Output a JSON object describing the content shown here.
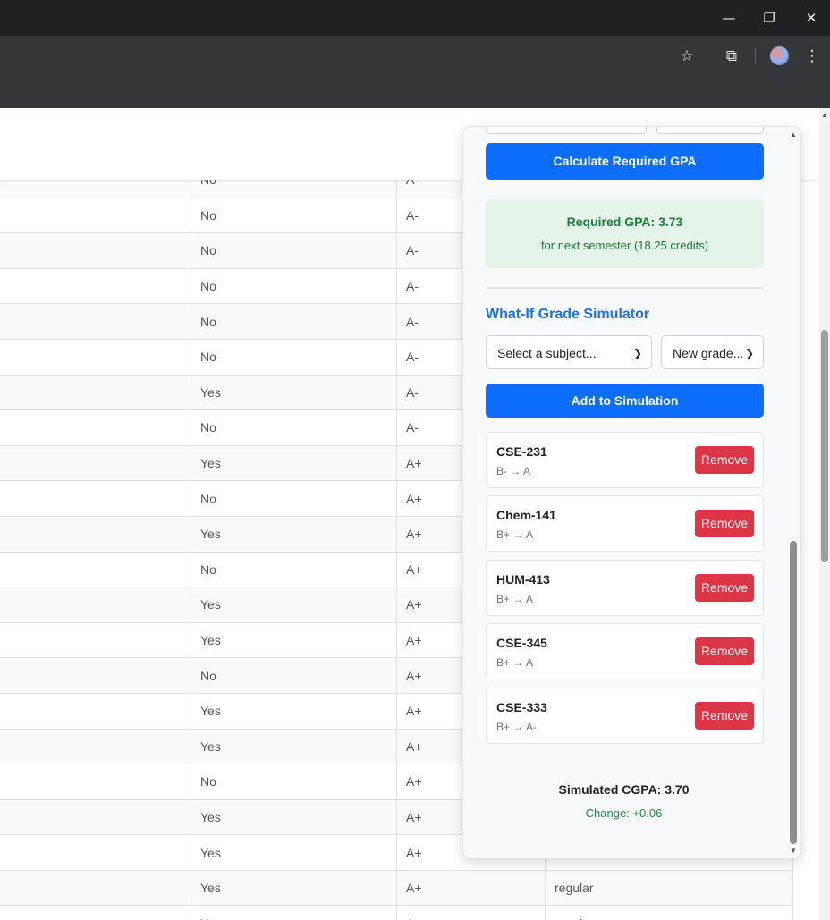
{
  "browser": {
    "minimize_glyph": "—",
    "restore_glyph": "❐",
    "close_glyph": "✕",
    "star_glyph": "☆",
    "extensions_glyph": "⧉",
    "menu_glyph": "⋮",
    "icons": [
      "minimize-icon",
      "restore-icon",
      "close-icon",
      "bookmark-star-icon",
      "extensions-icon",
      "profile-avatar",
      "menu-icon"
    ]
  },
  "table": {
    "rows": [
      {
        "col2": "No",
        "col3": "A-",
        "col4": ""
      },
      {
        "col2": "No",
        "col3": "A-",
        "col4": ""
      },
      {
        "col2": "No",
        "col3": "A-",
        "col4": ""
      },
      {
        "col2": "No",
        "col3": "A-",
        "col4": ""
      },
      {
        "col2": "No",
        "col3": "A-",
        "col4": ""
      },
      {
        "col2": "No",
        "col3": "A-",
        "col4": ""
      },
      {
        "col2": "Yes",
        "col3": "A-",
        "col4": ""
      },
      {
        "col2": "No",
        "col3": "A-",
        "col4": ""
      },
      {
        "col2": "Yes",
        "col3": "A+",
        "col4": ""
      },
      {
        "col2": "No",
        "col3": "A+",
        "col4": ""
      },
      {
        "col2": "Yes",
        "col3": "A+",
        "col4": ""
      },
      {
        "col2": "No",
        "col3": "A+",
        "col4": ""
      },
      {
        "col2": "Yes",
        "col3": "A+",
        "col4": ""
      },
      {
        "col2": "Yes",
        "col3": "A+",
        "col4": ""
      },
      {
        "col2": "No",
        "col3": "A+",
        "col4": ""
      },
      {
        "col2": "Yes",
        "col3": "A+",
        "col4": ""
      },
      {
        "col2": "Yes",
        "col3": "A+",
        "col4": ""
      },
      {
        "col2": "No",
        "col3": "A+",
        "col4": ""
      },
      {
        "col2": "Yes",
        "col3": "A+",
        "col4": ""
      },
      {
        "col2": "Yes",
        "col3": "A+",
        "col4": ""
      },
      {
        "col2": "Yes",
        "col3": "A+",
        "col4": "regular"
      },
      {
        "col2": "Yes",
        "col3": "A+",
        "col4": "regular"
      }
    ]
  },
  "panel": {
    "calculate_label": "Calculate Required GPA",
    "required_gpa_text": "Required GPA: 3.73",
    "required_gpa_sub": "for next semester (18.25 credits)",
    "simulator_title": "What-If Grade Simulator",
    "subject_select_value": "Select a subject...",
    "grade_select_value": "New grade...",
    "add_label": "Add to Simulation",
    "remove_label": "Remove",
    "simulations": [
      {
        "code": "CSE-231",
        "change": "B- → A"
      },
      {
        "code": "Chem-141",
        "change": "B+ → A"
      },
      {
        "code": "HUM-413",
        "change": "B+ → A"
      },
      {
        "code": "CSE-345",
        "change": "B+ → A"
      },
      {
        "code": "CSE-333",
        "change": "B+ → A-"
      }
    ],
    "simulated_cgpa": "Simulated CGPA: 3.70",
    "change_text": "Change: +0.06"
  },
  "colors": {
    "primary": "#0d6efd",
    "danger": "#dc3545",
    "success_bg": "#e4f4e8",
    "success_text": "#1e7a37",
    "title_blue": "#1a73e8"
  }
}
